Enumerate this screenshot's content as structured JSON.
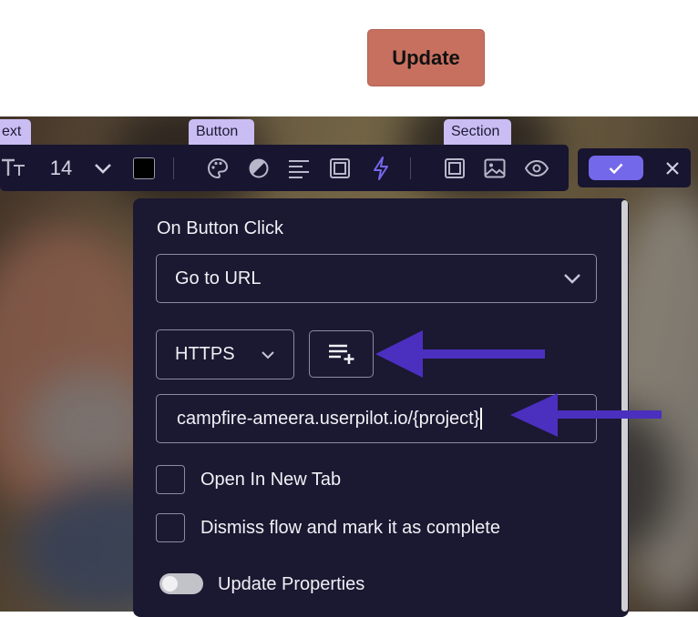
{
  "top": {
    "update_label": "Update"
  },
  "badges": {
    "text": "ext",
    "button": "Button",
    "section": "Section"
  },
  "toolbar": {
    "font_size": "14",
    "text_color": "#000000",
    "icons": [
      "font-size-icon",
      "chevron-down-icon",
      "color-swatch",
      "palette-icon",
      "contrast-icon",
      "align-left-icon",
      "frame-icon",
      "lightning-icon",
      "section-frame-icon",
      "image-icon",
      "eye-icon"
    ],
    "accent": "#7468ea"
  },
  "confirm": {
    "icons": [
      "check-icon",
      "close-icon"
    ]
  },
  "panel": {
    "title": "On Button Click",
    "action_select": "Go to URL",
    "protocol_select": "HTTPS",
    "url_value": "campfire-ameera.userpilot.io/{project}",
    "checkbox_new_tab": "Open In New Tab",
    "checkbox_dismiss": "Dismiss flow and mark it as complete",
    "toggle_update_properties": "Update Properties",
    "toggle_update_properties_on": false
  },
  "annotations": {
    "arrow_color": "#4b2fbf"
  }
}
